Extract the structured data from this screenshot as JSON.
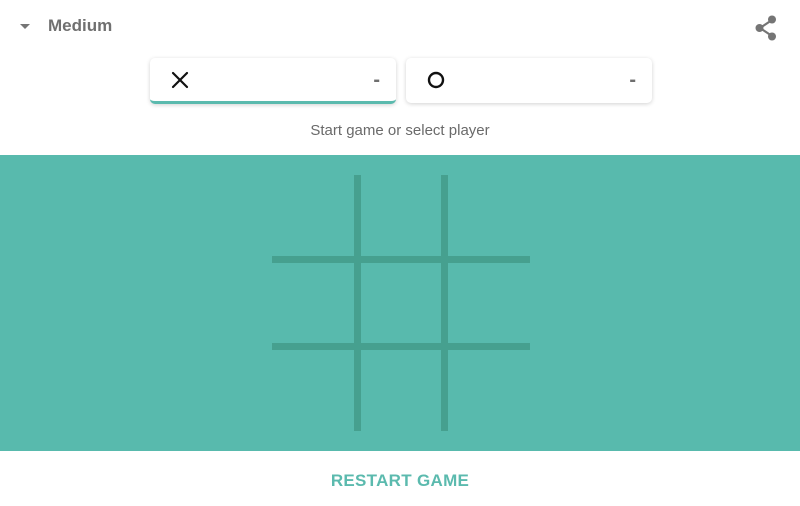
{
  "header": {
    "difficulty_label": "Medium",
    "caret_icon": "caret-down-icon",
    "share_icon": "share-icon"
  },
  "players": [
    {
      "symbol": "X",
      "score": "-",
      "active": true
    },
    {
      "symbol": "O",
      "score": "-",
      "active": false
    }
  ],
  "status_text": "Start game or select player",
  "board": {
    "cells": [
      "",
      "",
      "",
      "",
      "",
      "",
      "",
      "",
      ""
    ]
  },
  "restart_label": "RESTART GAME",
  "colors": {
    "accent": "#5bbaae",
    "board_background": "#58baad",
    "grid_lines": "#46a08f",
    "text_gray": "#707070"
  }
}
